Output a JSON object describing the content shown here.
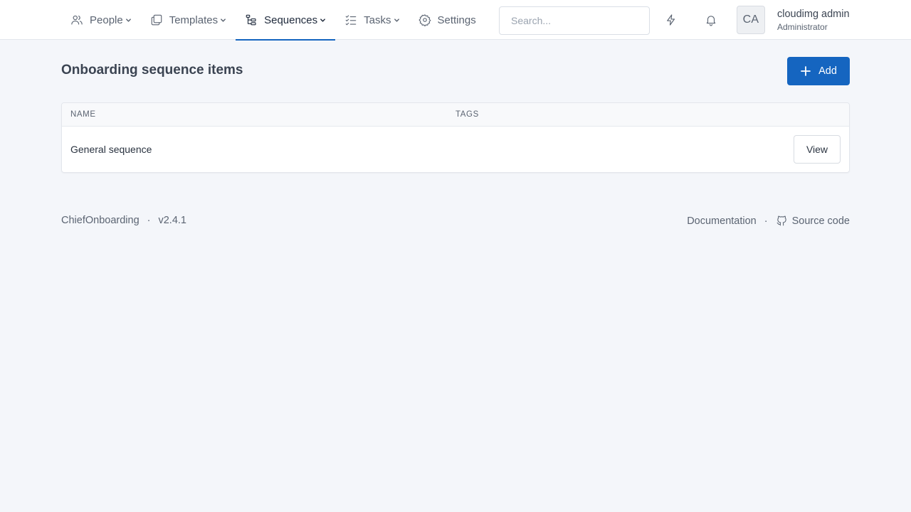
{
  "nav": {
    "items": [
      {
        "label": "People",
        "icon": "users-icon",
        "dropdown": true,
        "active": false
      },
      {
        "label": "Templates",
        "icon": "copy-icon",
        "dropdown": true,
        "active": false
      },
      {
        "label": "Sequences",
        "icon": "hierarchy-icon",
        "dropdown": true,
        "active": true
      },
      {
        "label": "Tasks",
        "icon": "list-check-icon",
        "dropdown": true,
        "active": false
      },
      {
        "label": "Settings",
        "icon": "gear-icon",
        "dropdown": false,
        "active": false
      }
    ]
  },
  "search": {
    "placeholder": "Search..."
  },
  "user": {
    "initials": "CA",
    "name": "cloudimg admin",
    "role": "Administrator"
  },
  "page": {
    "title": "Onboarding sequence items",
    "add_label": "Add"
  },
  "table": {
    "columns": [
      "NAME",
      "TAGS"
    ],
    "rows": [
      {
        "name": "General sequence",
        "tags": "",
        "action": "View"
      }
    ]
  },
  "footer": {
    "app_name": "ChiefOnboarding",
    "separator": "·",
    "version": "v2.4.1",
    "docs_label": "Documentation",
    "source_label": "Source code"
  },
  "colors": {
    "accent": "#1565c0",
    "background": "#f4f6fa"
  }
}
